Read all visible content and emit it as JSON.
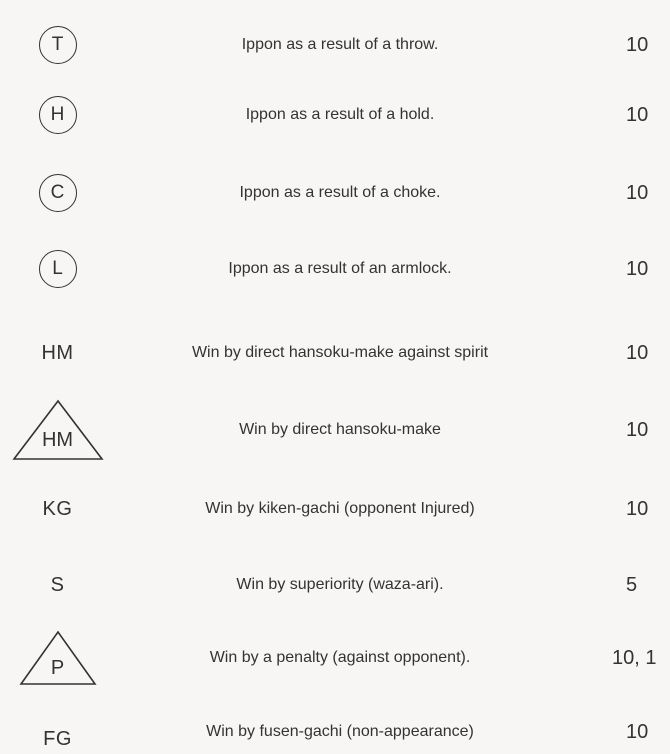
{
  "rows": [
    {
      "symbol": "T",
      "symbol_shape": "circle",
      "description": "Ippon as a result of a throw.",
      "score": "10"
    },
    {
      "symbol": "H",
      "symbol_shape": "circle",
      "description": "Ippon as a result of a hold.",
      "score": "10"
    },
    {
      "symbol": "C",
      "symbol_shape": "circle",
      "description": "Ippon as a result of a choke.",
      "score": "10"
    },
    {
      "symbol": "L",
      "symbol_shape": "circle",
      "description": "Ippon as a result of an armlock.",
      "score": "10"
    },
    {
      "symbol": "HM",
      "symbol_shape": "plain",
      "description": "Win by direct hansoku-make against spirit",
      "score": "10"
    },
    {
      "symbol": "HM",
      "symbol_shape": "triangle",
      "description": "Win by direct hansoku-make",
      "score": "10"
    },
    {
      "symbol": "KG",
      "symbol_shape": "plain",
      "description": "Win by kiken-gachi (opponent Injured)",
      "score": "10"
    },
    {
      "symbol": "S",
      "symbol_shape": "plain",
      "description": "Win by superiority (waza-ari).",
      "score": "5"
    },
    {
      "symbol": "P",
      "symbol_shape": "triangle",
      "description": "Win by a penalty (against opponent).",
      "score": "10, 1"
    },
    {
      "symbol": "FG",
      "symbol_shape": "plain",
      "description": "Win by fusen-gachi (non-appearance)",
      "score": "10"
    }
  ]
}
